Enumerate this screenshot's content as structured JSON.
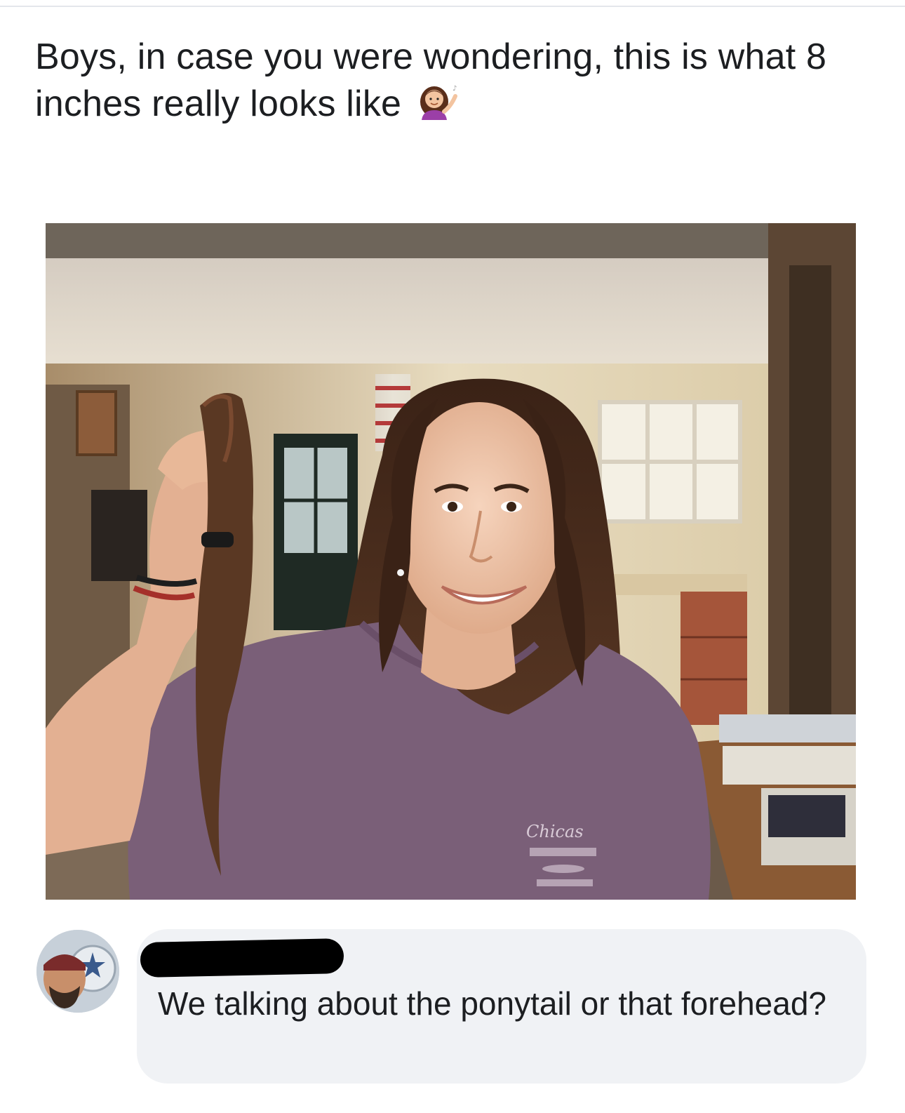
{
  "post": {
    "text": "Boys, in case you were wondering, this is what 8 inches really looks like",
    "emoji": "woman-tipping-hand-icon"
  },
  "photo": {
    "shirt_text": "Chicas"
  },
  "comment": {
    "author": "",
    "text": "We talking about the ponytail or that forehead?"
  },
  "colors": {
    "text": "#1c1e21",
    "bubble": "#f0f2f5",
    "shirt": "#7a5f78",
    "hair": "#4a2e1e"
  }
}
